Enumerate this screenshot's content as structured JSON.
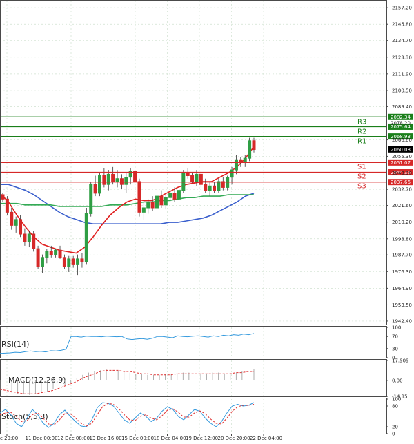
{
  "chart_data": {
    "type": "candlestick",
    "title": "",
    "colors": {
      "up": "#2f9e44",
      "down": "#d62828",
      "resistance": "#1a7f1a",
      "support": "#d62828",
      "ma_fast": "#e02020",
      "ma_mid": "#33aa55",
      "ma_slow": "#3a5fcd",
      "indicator_line": "#3399dd",
      "signal_line": "#e03030",
      "grid": "#cfe0cf",
      "last_price_badge": "#000000"
    },
    "price_axis": {
      "range": [
        1940,
        2162
      ],
      "ticks": [
        "2157.20",
        "2145.80",
        "2134.70",
        "2123.30",
        "2111.90",
        "2100.50",
        "2089.40",
        "2066.60",
        "2055.30",
        "2043.90",
        "2032.70",
        "2021.60",
        "2010.20",
        "1998.80",
        "1987.70",
        "1976.30",
        "1964.90",
        "1953.50",
        "1942.40"
      ],
      "grid": true
    },
    "time_axis": {
      "labels": [
        "c 20:00",
        "11 Dec 00:00",
        "12 Dec 08:00",
        "13 Dec 16:00",
        "15 Dec 00:00",
        "18 Dec 04:00",
        "19 Dec 12:00",
        "20 Dec 20:00",
        "22 Dec 04:00"
      ]
    },
    "levels": [
      {
        "name": "R3",
        "value": "2082.34",
        "kind": "resistance"
      },
      {
        "name": "R2",
        "value": "2075.64",
        "kind": "resistance"
      },
      {
        "name": "R1",
        "value": "2068.93",
        "kind": "resistance"
      },
      {
        "name": "S1",
        "value": "2051.07",
        "kind": "support"
      },
      {
        "name": "S2",
        "value": "2044.36",
        "kind": "support"
      },
      {
        "name": "S3",
        "value": "2037.66",
        "kind": "support"
      }
    ],
    "last_price": "2060.08",
    "overlap_tick": "2078.20",
    "candles": [
      [
        2029,
        2030,
        2024,
        2026
      ],
      [
        2026,
        2028,
        2015,
        2017
      ],
      [
        2017,
        2020,
        2005,
        2008
      ],
      [
        2008,
        2014,
        2003,
        2012
      ],
      [
        2012,
        2015,
        2000,
        2002
      ],
      [
        2002,
        2006,
        1994,
        1997
      ],
      [
        1997,
        2004,
        1993,
        2002
      ],
      [
        2002,
        2004,
        1990,
        1992
      ],
      [
        1992,
        1994,
        1978,
        1980
      ],
      [
        1980,
        1988,
        1975,
        1986
      ],
      [
        1986,
        1992,
        1982,
        1990
      ],
      [
        1990,
        1994,
        1986,
        1988
      ],
      [
        1988,
        1992,
        1986,
        1991
      ],
      [
        1991,
        1994,
        1985,
        1986
      ],
      [
        1986,
        1988,
        1978,
        1980
      ],
      [
        1980,
        1987,
        1976,
        1985
      ],
      [
        1985,
        1987,
        1979,
        1981
      ],
      [
        1981,
        1988,
        1974,
        1985
      ],
      [
        1985,
        1989,
        1979,
        1983
      ],
      [
        1983,
        2020,
        1981,
        2016
      ],
      [
        2016,
        2038,
        2014,
        2036
      ],
      [
        2036,
        2042,
        2028,
        2030
      ],
      [
        2030,
        2044,
        2028,
        2042
      ],
      [
        2042,
        2047,
        2034,
        2036
      ],
      [
        2036,
        2046,
        2032,
        2043
      ],
      [
        2043,
        2048,
        2036,
        2038
      ],
      [
        2038,
        2046,
        2034,
        2040
      ],
      [
        2040,
        2043,
        2033,
        2036
      ],
      [
        2036,
        2044,
        2030,
        2041
      ],
      [
        2041,
        2047,
        2036,
        2045
      ],
      [
        2045,
        2047,
        2036,
        2038
      ],
      [
        2038,
        2040,
        2014,
        2017
      ],
      [
        2017,
        2024,
        2012,
        2020
      ],
      [
        2020,
        2026,
        2016,
        2024
      ],
      [
        2024,
        2028,
        2018,
        2020
      ],
      [
        2020,
        2030,
        2018,
        2028
      ],
      [
        2028,
        2032,
        2020,
        2022
      ],
      [
        2022,
        2029,
        2019,
        2027
      ],
      [
        2027,
        2032,
        2024,
        2030
      ],
      [
        2030,
        2034,
        2024,
        2026
      ],
      [
        2026,
        2034,
        2022,
        2032
      ],
      [
        2032,
        2046,
        2030,
        2044
      ],
      [
        2044,
        2047,
        2040,
        2042
      ],
      [
        2042,
        2044,
        2037,
        2038
      ],
      [
        2038,
        2046,
        2035,
        2043
      ],
      [
        2043,
        2045,
        2034,
        2036
      ],
      [
        2036,
        2040,
        2030,
        2032
      ],
      [
        2032,
        2038,
        2028,
        2035
      ],
      [
        2035,
        2038,
        2030,
        2032
      ],
      [
        2032,
        2040,
        2030,
        2038
      ],
      [
        2038,
        2041,
        2032,
        2034
      ],
      [
        2034,
        2042,
        2032,
        2041
      ],
      [
        2041,
        2048,
        2036,
        2046
      ],
      [
        2046,
        2056,
        2043,
        2053
      ],
      [
        2053,
        2055,
        2048,
        2051
      ],
      [
        2051,
        2056,
        2048,
        2054
      ],
      [
        2054,
        2068,
        2052,
        2066
      ],
      [
        2066,
        2068,
        2058,
        2060
      ]
    ],
    "ma_fast": [
      2030,
      2024,
      2015,
      2007,
      2000,
      1995,
      1993,
      1991,
      1990,
      1989,
      1993,
      2000,
      2008,
      2015,
      2020,
      2024,
      2026,
      2025,
      2025,
      2028,
      2031,
      2034,
      2036,
      2037,
      2038,
      2038,
      2041,
      2044,
      2048,
      2054,
      2062
    ],
    "ma_mid": [
      2023,
      2023,
      2023,
      2022,
      2022,
      2022,
      2022,
      2021,
      2021,
      2021,
      2021,
      2021,
      2021,
      2022,
      2022,
      2022,
      2023,
      2024,
      2024,
      2025,
      2025,
      2026,
      2027,
      2027,
      2028,
      2028,
      2028,
      2029,
      2029,
      2029,
      2029
    ],
    "ma_slow": [
      2036,
      2036,
      2034,
      2032,
      2029,
      2025,
      2021,
      2017,
      2014,
      2012,
      2010,
      2009,
      2009,
      2009,
      2009,
      2009,
      2009,
      2009,
      2009,
      2009,
      2010,
      2010,
      2011,
      2012,
      2013,
      2015,
      2018,
      2021,
      2024,
      2028,
      2030
    ],
    "indicators": [
      {
        "name": "RSI(14)",
        "range": [
          0,
          100
        ],
        "ticks": [
          "100",
          "70",
          "30",
          "0"
        ],
        "line": [
          14,
          15,
          16,
          18,
          17,
          20,
          22,
          20,
          21,
          19,
          23,
          22,
          24,
          28,
          70,
          70,
          68,
          71,
          70,
          70,
          69,
          71,
          70,
          69,
          70,
          62,
          60,
          62,
          63,
          61,
          64,
          70,
          70,
          68,
          66,
          72,
          70,
          69,
          71,
          72,
          70,
          68,
          72,
          70,
          74,
          72,
          76,
          74,
          78,
          76,
          80
        ]
      },
      {
        "name": "MACD(12,26,9)",
        "range": [
          -14.35,
          17.909
        ],
        "ticks": [
          "17.909",
          "0.00",
          "-14.35"
        ],
        "hist": [
          -9,
          -10,
          -11,
          -12,
          -12,
          -13,
          -12,
          -11,
          -10,
          -8,
          -6,
          -4,
          -2,
          2,
          5,
          7,
          8,
          9,
          10,
          10,
          9,
          8,
          7,
          6,
          6,
          5,
          5,
          5,
          6,
          6,
          6,
          7,
          7,
          7,
          6,
          6,
          7,
          7,
          6,
          6,
          7,
          8,
          9,
          10
        ],
        "signal": [
          -8,
          -9,
          -10,
          -11,
          -12,
          -12,
          -12,
          -11,
          -10,
          -9,
          -7,
          -5,
          -3,
          -1,
          2,
          4,
          6,
          8,
          9,
          9,
          9,
          8,
          8,
          7,
          6,
          6,
          5,
          5,
          5,
          5,
          6,
          6,
          6,
          6,
          6,
          6,
          6,
          6,
          6,
          6,
          7,
          7,
          8,
          8
        ]
      },
      {
        "name": "Stoch(5,5,3)",
        "range": [
          0,
          100
        ],
        "ticks": [
          "100",
          "80",
          "20",
          "0"
        ],
        "k": [
          60,
          70,
          55,
          30,
          20,
          45,
          70,
          55,
          30,
          18,
          30,
          55,
          68,
          50,
          35,
          22,
          20,
          40,
          75,
          90,
          88,
          80,
          60,
          40,
          30,
          45,
          60,
          50,
          35,
          45,
          65,
          78,
          70,
          50,
          40,
          55,
          70,
          65,
          45,
          30,
          20,
          35,
          60,
          80,
          85,
          80,
          82,
          90
        ],
        "d": [
          55,
          60,
          62,
          50,
          35,
          38,
          55,
          60,
          45,
          28,
          25,
          40,
          58,
          58,
          45,
          30,
          22,
          30,
          55,
          78,
          88,
          85,
          72,
          55,
          40,
          38,
          50,
          55,
          45,
          40,
          52,
          68,
          72,
          62,
          48,
          48,
          60,
          66,
          58,
          42,
          30,
          28,
          45,
          65,
          78,
          82,
          82,
          85
        ]
      }
    ]
  }
}
